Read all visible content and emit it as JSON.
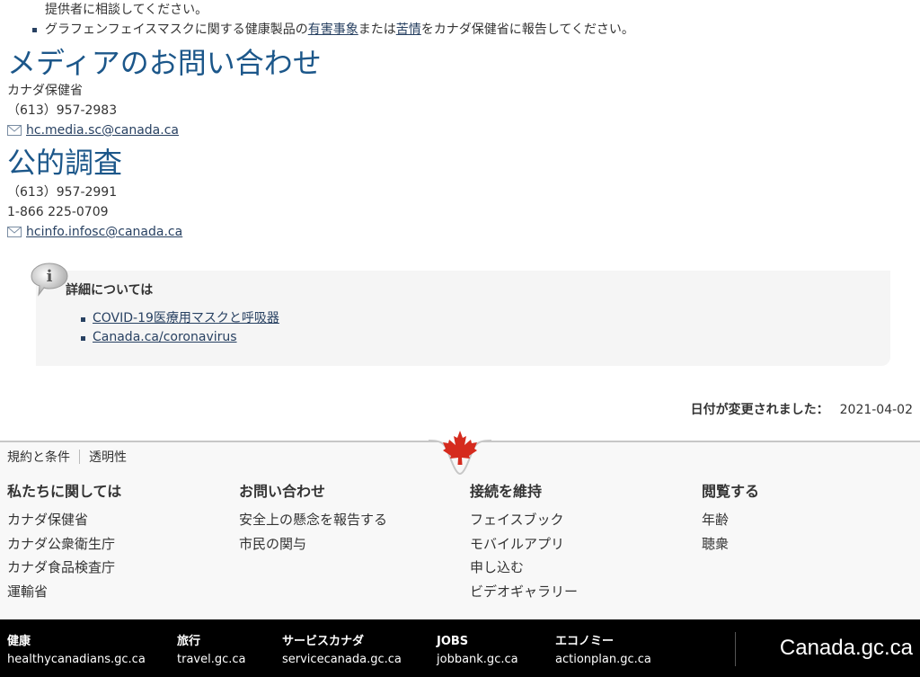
{
  "top_list": {
    "continued_text": "提供者に相談してください。",
    "item_prefix": "グラフェンフェイスマスクに関する健康製品の",
    "link_adverse": "有害事象",
    "item_middle": "または",
    "link_complaint": "苦情",
    "item_suffix": "をカナダ保健省に報告してください。"
  },
  "media": {
    "heading": "メディアのお問い合わせ",
    "org": "カナダ保健省",
    "phone": "（613）957-2983",
    "email": "hc.media.sc@canada.ca"
  },
  "public": {
    "heading": "公的調査",
    "phone": "（613）957-2991",
    "tollfree": "1-866 225-0709",
    "email": "hcinfo.infosc@canada.ca"
  },
  "more_info": {
    "title": "詳細については",
    "links": [
      "COVID-19医療用マスクと呼吸器",
      "Canada.ca/coronavirus"
    ]
  },
  "date_modified": {
    "label": "日付が変更されました：",
    "value": "2021-04-02"
  },
  "footer": {
    "terms": "規約と条件",
    "transparency": "透明性",
    "columns": [
      {
        "title": "私たちに関しては",
        "links": [
          "カナダ保健省",
          "カナダ公衆衛生庁",
          "カナダ食品検査庁",
          "運輸省"
        ]
      },
      {
        "title": "お問い合わせ",
        "links": [
          "安全上の懸念を報告する",
          "市民の関与"
        ]
      },
      {
        "title": "接続を維持",
        "links": [
          "フェイスブック",
          "モバイルアプリ",
          "申し込む",
          "ビデオギャラリー"
        ]
      },
      {
        "title": "閲覧する",
        "links": [
          "年齢",
          "聴衆"
        ]
      }
    ]
  },
  "bottom_bar": {
    "columns": [
      {
        "title": "健康",
        "link": "healthycanadians.gc.ca"
      },
      {
        "title": "旅行",
        "link": "travel.gc.ca"
      },
      {
        "title": "サービスカナダ",
        "link": "servicecanada.gc.ca"
      },
      {
        "title": "JOBS",
        "link": "jobbank.gc.ca"
      },
      {
        "title": "エコノミー",
        "link": "actionplan.gc.ca"
      }
    ],
    "site_link": "Canada.gc.ca"
  },
  "colors": {
    "heading": "#1c578a",
    "link": "#284162",
    "footer_bg": "#f8f8f8",
    "bottom_bg": "#000000",
    "maple": "#d52b1e"
  },
  "icons": [
    "mail-icon",
    "info-bubble-icon",
    "maple-leaf-icon"
  ]
}
